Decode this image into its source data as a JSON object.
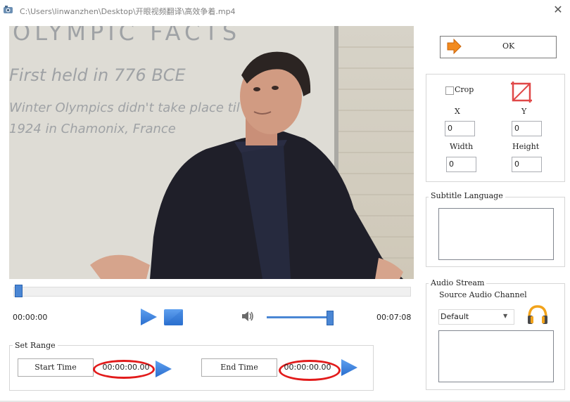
{
  "window": {
    "title": "C:\\Users\\linwanzhen\\Desktop\\开眼视频翻译\\高效争着.mp4",
    "close_glyph": "✕"
  },
  "video": {
    "whiteboard_lines": [
      "OLYMPIC FACTS",
      "First held in 776 BCE",
      "Winter Olympics didn't take place til",
      "1924 in Chamonix, France"
    ]
  },
  "player": {
    "current_time": "00:00:00",
    "duration": "00:07:08",
    "seek_position": 0,
    "volume_level": 0.95
  },
  "set_range": {
    "legend": "Set Range",
    "start_button": "Start Time",
    "start_value": "00:00:00.00",
    "end_button": "End Time",
    "end_value": "00:00:00.00"
  },
  "ok_button": {
    "label": "OK"
  },
  "crop": {
    "label": "Crop",
    "checked": false,
    "x_label": "X",
    "x_value": "0",
    "y_label": "Y",
    "y_value": "0",
    "width_label": "Width",
    "width_value": "0",
    "height_label": "Height",
    "height_value": "0"
  },
  "subtitle": {
    "legend": "Subtitle Language"
  },
  "audio": {
    "legend": "Audio Stream",
    "source_label": "Source Audio Channel",
    "selected": "Default"
  },
  "colors": {
    "accent_blue": "#4a86d4",
    "range_highlight": "#e21b1b",
    "ok_arrow": "#f28a1e"
  },
  "icons": {
    "app": "app-icon",
    "play": "play-icon",
    "stop": "stop-icon",
    "volume": "speaker-icon",
    "ok": "arrow-right-icon",
    "crop": "crop-icon",
    "audio": "headphones-icon"
  }
}
